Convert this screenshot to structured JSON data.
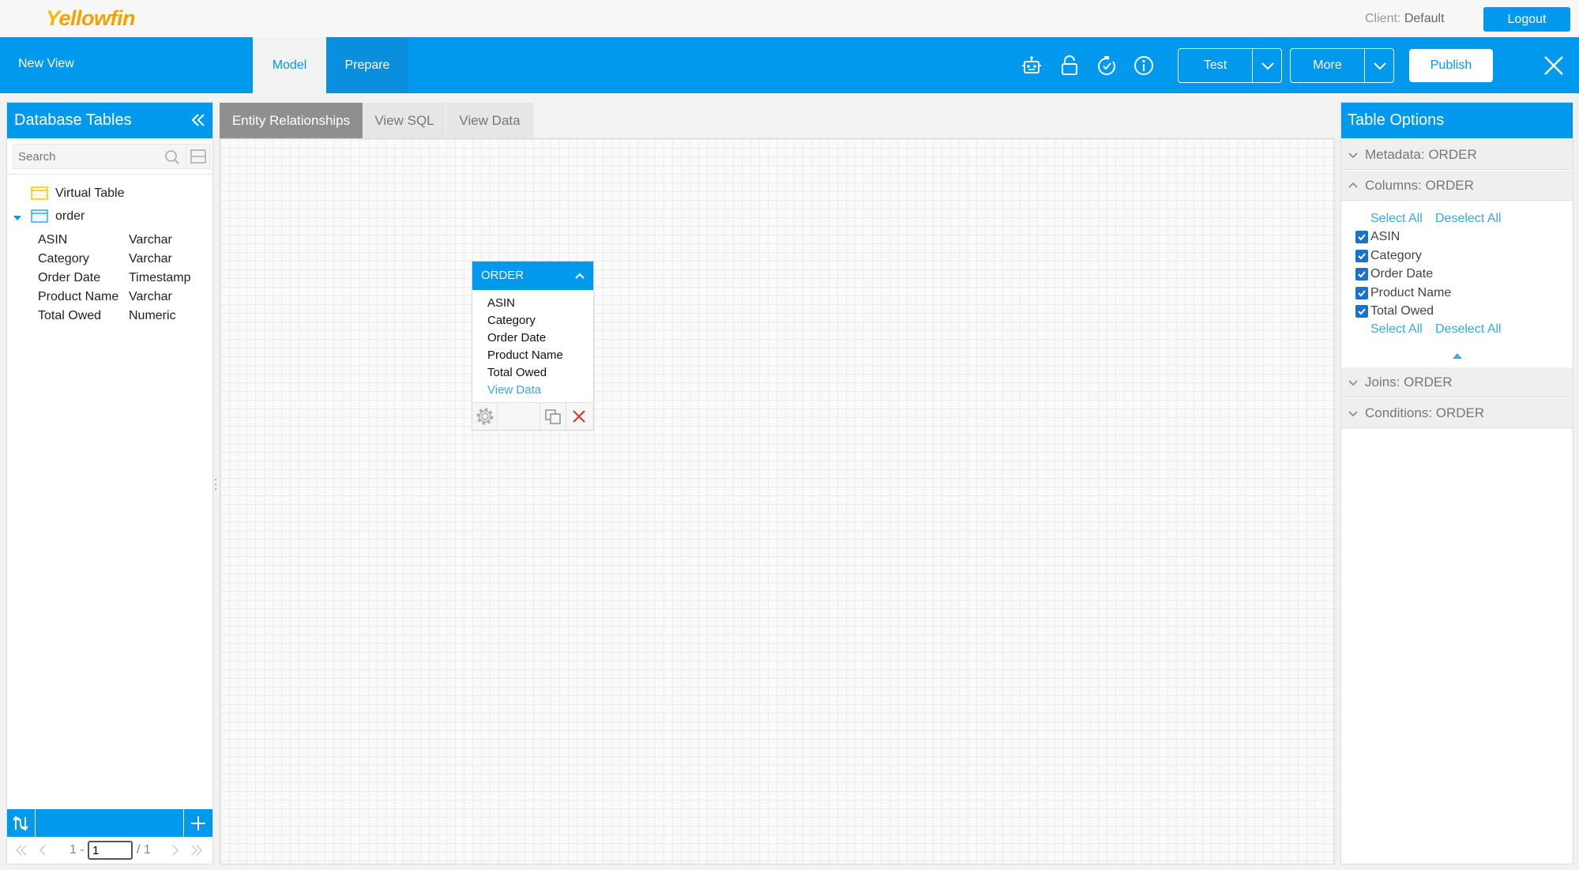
{
  "brand": {
    "logo_first": "Y",
    "logo_rest": "ellowfin",
    "accent": "#0099ee"
  },
  "top": {
    "client_label": "Client:",
    "client_value": "Default",
    "logout": "Logout"
  },
  "toolbar": {
    "view_name": "New View",
    "tabs": [
      {
        "label": "Model",
        "active": true
      },
      {
        "label": "Prepare",
        "active": false
      }
    ],
    "icons": [
      "robot-icon",
      "lock-icon",
      "timer-icon",
      "info-icon"
    ],
    "test_label": "Test",
    "more_label": "More",
    "publish_label": "Publish"
  },
  "left": {
    "title": "Database Tables",
    "search_placeholder": "Search",
    "tree": [
      {
        "label": "Virtual Table"
      },
      {
        "label": "order",
        "expanded": true
      }
    ],
    "columns": [
      {
        "name": "ASIN",
        "type": "Varchar"
      },
      {
        "name": "Category",
        "type": "Varchar"
      },
      {
        "name": "Order Date",
        "type": "Timestamp"
      },
      {
        "name": "Product Name",
        "type": "Varchar"
      },
      {
        "name": "Total Owed",
        "type": "Numeric"
      }
    ],
    "pager": {
      "prefix": "1 -",
      "current": "1",
      "total": "/ 1"
    }
  },
  "center": {
    "tabs": [
      {
        "label": "Entity Relationships",
        "active": true
      },
      {
        "label": "View SQL",
        "active": false
      },
      {
        "label": "View Data",
        "active": false
      }
    ],
    "entity": {
      "title": "ORDER",
      "fields": [
        "ASIN",
        "Category",
        "Order Date",
        "Product Name",
        "Total Owed"
      ],
      "link": "View Data"
    }
  },
  "right": {
    "title": "Table Options",
    "sections": {
      "metadata": "Metadata: ORDER",
      "columns": "Columns: ORDER",
      "joins": "Joins: ORDER",
      "conditions": "Conditions: ORDER"
    },
    "select_all": "Select All",
    "deselect_all": "Deselect All",
    "columns": [
      {
        "name": "ASIN",
        "checked": true
      },
      {
        "name": "Category",
        "checked": true
      },
      {
        "name": "Order Date",
        "checked": true
      },
      {
        "name": "Product Name",
        "checked": true
      },
      {
        "name": "Total Owed",
        "checked": true
      }
    ]
  }
}
